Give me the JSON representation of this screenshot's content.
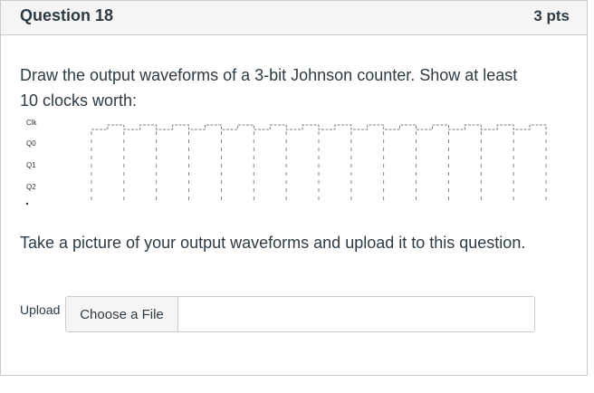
{
  "header": {
    "title": "Question 18",
    "points": "3 pts"
  },
  "prompt": {
    "line1": "Draw the output waveforms of a 3-bit Johnson counter.  Show at least",
    "line2": "10 clocks worth:"
  },
  "waveform": {
    "labels": [
      "Clk",
      "Q0",
      "Q1",
      "Q2"
    ],
    "clock_cycles": 14
  },
  "instruction": "Take a picture of your output waveforms and upload it to this question.",
  "upload": {
    "label": "Upload",
    "button": "Choose a File"
  }
}
